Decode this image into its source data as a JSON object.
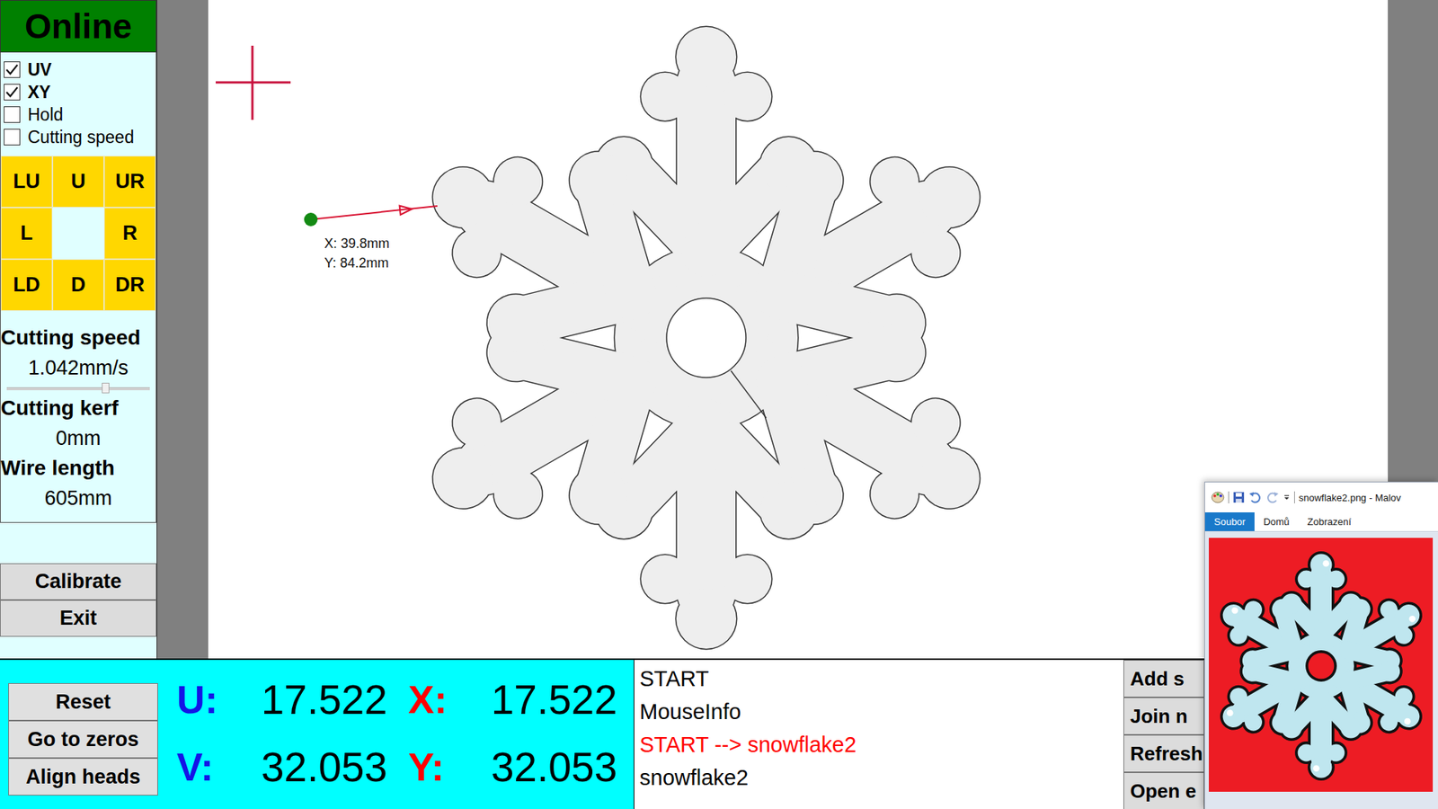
{
  "status": {
    "label": "Online"
  },
  "options": [
    {
      "label": "UV",
      "checked": true
    },
    {
      "label": "XY",
      "checked": true
    },
    {
      "label": "Hold",
      "checked": false
    },
    {
      "label": "Cutting speed",
      "checked": false
    }
  ],
  "jog_keys": [
    {
      "label": "LU",
      "kind": "key"
    },
    {
      "label": "U",
      "kind": "key"
    },
    {
      "label": "UR",
      "kind": "key"
    },
    {
      "label": "L",
      "kind": "key"
    },
    {
      "kind": "blank"
    },
    {
      "label": "R",
      "kind": "key"
    },
    {
      "label": "LD",
      "kind": "key"
    },
    {
      "label": "D",
      "kind": "key"
    },
    {
      "label": "DR",
      "kind": "key"
    }
  ],
  "settings": [
    {
      "label": "Cutting speed",
      "value": "1.042mm/s",
      "kind": "slider",
      "level": 0.69
    },
    {
      "label": "Cutting kerf",
      "value": "0mm",
      "kind": "text"
    },
    {
      "label": "Wire length",
      "value": "605mm",
      "kind": "text"
    }
  ],
  "side_buttons": [
    "Calibrate",
    "Exit"
  ],
  "canvas": {
    "marker": {
      "x": "X: 39.8mm",
      "y": "Y: 84.2mm"
    }
  },
  "bottom_buttons": [
    "Reset",
    "Go to zeros",
    "Align heads"
  ],
  "axes": [
    {
      "label": "U:",
      "value": "17.522",
      "color": "#1414e6"
    },
    {
      "label": "X:",
      "value": "17.522",
      "color": "#ff0000"
    },
    {
      "label": "V:",
      "value": "32.053",
      "color": "#1414e6"
    },
    {
      "label": "Y:",
      "value": "32.053",
      "color": "#ff0000"
    }
  ],
  "log": [
    {
      "text": "START",
      "color": "#000000"
    },
    {
      "text": "MouseInfo",
      "color": "#000000"
    },
    {
      "text": "START --> snowflake2",
      "color": "#ff0000"
    },
    {
      "text": "snowflake2",
      "color": "#000000"
    }
  ],
  "actions": [
    "Add s",
    "Join n",
    "Refresh",
    "Open e"
  ],
  "paint_window": {
    "title": "snowflake2.png - Malov",
    "tabs": [
      {
        "label": "Soubor",
        "selected": true
      },
      {
        "label": "Domů",
        "selected": false
      },
      {
        "label": "Zobrazení",
        "selected": false
      }
    ]
  }
}
